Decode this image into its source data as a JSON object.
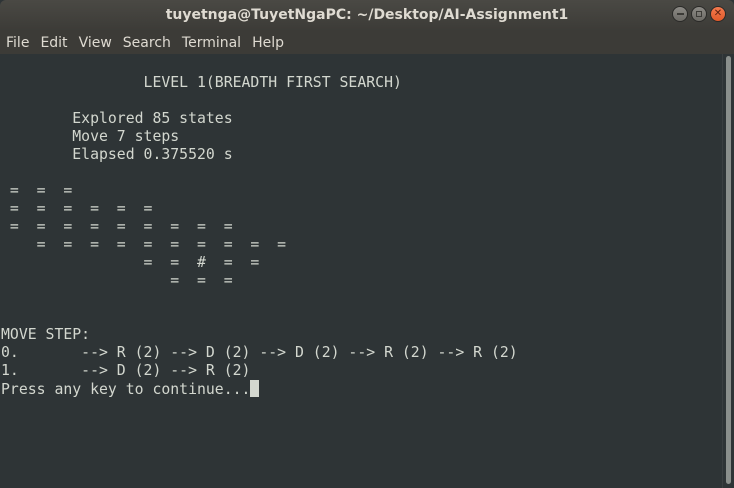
{
  "window": {
    "title": "tuyetnga@TuyetNgaPC: ~/Desktop/AI-Assignment1",
    "buttons": {
      "minimize": "minimize-icon",
      "maximize": "maximize-icon",
      "close": "close-icon"
    }
  },
  "menu": [
    "File",
    "Edit",
    "View",
    "Search",
    "Terminal",
    "Help"
  ],
  "terminal": {
    "lines": [
      "                LEVEL 1(BREADTH FIRST SEARCH)",
      "",
      "        Explored 85 states",
      "        Move 7 steps",
      "        Elapsed 0.375520 s",
      "",
      " =  =  =",
      " =  =  =  =  =  =",
      " =  =  =  =  =  =  =  =  =",
      "    =  =  =  =  =  =  =  =  =  =",
      "                =  =  #  =  =",
      "                   =  =  =",
      "",
      "",
      "MOVE STEP:",
      "0.       --> R (2) --> D (2) --> D (2) --> R (2) --> R (2)",
      "1.       --> D (2) --> R (2)",
      "Press any key to continue..."
    ]
  },
  "colors": {
    "terminal_bg": "#2e3436",
    "terminal_fg": "#d3d7cf",
    "titlebar": "#3c3b37",
    "close": "#e95420"
  }
}
